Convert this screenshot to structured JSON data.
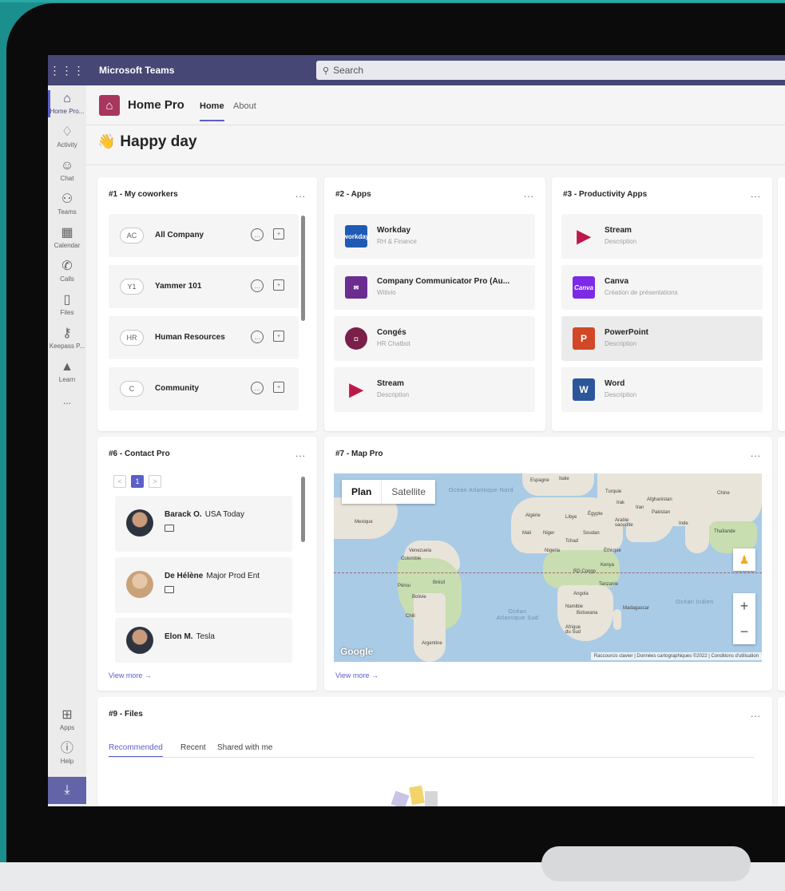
{
  "topbar": {
    "app_name": "Microsoft Teams",
    "search_placeholder": "Search"
  },
  "rail": {
    "items": [
      {
        "label": "Home Pro...",
        "icon": "home-icon"
      },
      {
        "label": "Activity",
        "icon": "bell-icon"
      },
      {
        "label": "Chat",
        "icon": "chat-icon"
      },
      {
        "label": "Teams",
        "icon": "teams-icon"
      },
      {
        "label": "Calendar",
        "icon": "calendar-icon"
      },
      {
        "label": "Calls",
        "icon": "phone-icon"
      },
      {
        "label": "Files",
        "icon": "file-icon"
      },
      {
        "label": "Keepass P...",
        "icon": "key-icon"
      },
      {
        "label": "Learn",
        "icon": "graduation-cap-icon"
      }
    ],
    "more": "...",
    "apps_label": "Apps",
    "help_label": "Help"
  },
  "header": {
    "title": "Home Pro",
    "tabs": [
      {
        "label": "Home",
        "active": true
      },
      {
        "label": "About",
        "active": false
      }
    ],
    "greeting": "Happy day"
  },
  "coworkers": {
    "title": "#1 - My coworkers",
    "more": "...",
    "items": [
      {
        "initials": "AC",
        "name": "All Company"
      },
      {
        "initials": "Y1",
        "name": "Yammer 101"
      },
      {
        "initials": "HR",
        "name": "Human Resources"
      },
      {
        "initials": "C",
        "name": "Community"
      }
    ]
  },
  "apps": {
    "title": "#2 - Apps",
    "more": "...",
    "items": [
      {
        "name": "Workday",
        "desc": "RH & Finance",
        "icon_text": "workday",
        "color": "#1f5bb5"
      },
      {
        "name": "Company Communicator Pro (Au...",
        "desc": "Witivio",
        "icon_text": "",
        "color": "#6b2d8f"
      },
      {
        "name": "Congés",
        "desc": "HR Chatbot",
        "icon_text": "",
        "color": "#7a1f4a"
      },
      {
        "name": "Stream",
        "desc": "Description",
        "icon_text": "",
        "color": "#bc1948"
      }
    ]
  },
  "productivity": {
    "title": "#3 - Productivity Apps",
    "more": "...",
    "items": [
      {
        "name": "Stream",
        "desc": "Description",
        "icon_text": "",
        "color": "#bc1948"
      },
      {
        "name": "Canva",
        "desc": "Création de présentations",
        "icon_text": "Canva",
        "color": "#7d2ae8"
      },
      {
        "name": "PowerPoint",
        "desc": "Description",
        "icon_text": "P",
        "color": "#d24726"
      },
      {
        "name": "Word",
        "desc": "Description",
        "icon_text": "W",
        "color": "#2b579a"
      }
    ]
  },
  "contact": {
    "title": "#6 - Contact Pro",
    "more": "...",
    "pager": {
      "prev": "<",
      "current": "1",
      "next": ">"
    },
    "items": [
      {
        "name": "Barack O.",
        "org": "USA Today",
        "has_mail": true
      },
      {
        "name": "De Hélène",
        "org": "Major Prod Ent",
        "has_mail": true
      },
      {
        "name": "Elon M.",
        "org": "Tesla",
        "has_mail": false
      }
    ],
    "view_more": "View more →"
  },
  "map": {
    "title": "#7 - Map Pro",
    "more": "...",
    "toggle": {
      "plan": "Plan",
      "satellite": "Satellite"
    },
    "labels": {
      "espagne": "Espagne",
      "italie": "Italie",
      "turquie": "Turquie",
      "chine": "Chine",
      "irak": "Irak",
      "iran": "Iran",
      "afghanistan": "Afghanistan",
      "pakistan": "Pakistan",
      "algerie": "Algérie",
      "libye": "Libye",
      "egypte": "Égypte",
      "arabie": "Arabie saoudite",
      "inde": "Inde",
      "mexique": "Mexique",
      "mali": "Mali",
      "niger": "Niger",
      "tchad": "Tchad",
      "soudan": "Soudan",
      "thailande": "Thaïlande",
      "venezuela": "Venezuela",
      "nigeria": "Nigeria",
      "ethiopie": "Éthiopie",
      "colombie": "Colombie",
      "rdcongo": "RD Congo",
      "kenya": "Kenya",
      "perou": "Pérou",
      "bresil": "Brésil",
      "tanzanie": "Tanzanie",
      "bolivie": "Bolivie",
      "angola": "Angola",
      "namibie": "Namibie",
      "botswana": "Botswana",
      "madagascar": "Madagascar",
      "chili": "Chili",
      "afriquedusud": "Afrique du Sud",
      "argentine": "Argentine",
      "ocean_nord": "Océan Atlantique Nord",
      "ocean_sud": "Océan Atlantique Sud",
      "ocean_indien": "Océan Indien"
    },
    "google": "Google",
    "attribution": "Raccourcis clavier | Données cartographiques ©2022 | Conditions d'utilisation",
    "view_more": "View more →"
  },
  "files": {
    "title": "#9 - Files",
    "more": "...",
    "tabs": [
      {
        "label": "Recommended",
        "active": true
      },
      {
        "label": "Recent",
        "active": false
      },
      {
        "label": "Shared with me",
        "active": false
      }
    ]
  }
}
